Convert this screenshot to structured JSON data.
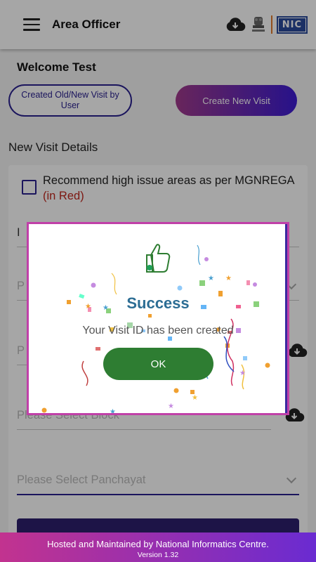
{
  "appbar": {
    "title": "Area Officer",
    "logo_text": "NIC"
  },
  "welcome": "Welcome Test",
  "buttons": {
    "created_visit": "Created Old/New Visit by User",
    "create_new": "Create New Visit"
  },
  "section_title": "New Visit Details",
  "recommend": {
    "text": "Recommend high issue areas as per MGNREGA ",
    "red_text": "(in Red)",
    "checked": false
  },
  "fields": {
    "field1_partial": "I",
    "field2_partial": "P",
    "field3_partial": "P",
    "block_placeholder": "Please Select Block",
    "panchayat_placeholder": "Please Select Panchayat"
  },
  "dialog": {
    "title": "Success",
    "message": "Your Visit ID has been created",
    "ok_label": "OK"
  },
  "footer": {
    "main": "Hosted and Maintained by National Informatics Centre.",
    "version": "Version 1.32"
  },
  "colors": {
    "primary": "#2a2190",
    "accent_gradient_start": "#a13a8c",
    "accent_gradient_end": "#3d1cd4",
    "success_green": "#2e7d32",
    "success_title": "#2c6d94",
    "red_note": "#c0271e"
  },
  "icons": {
    "menu": "hamburger-menu-icon",
    "download": "cloud-download-icon",
    "emblem": "state-emblem-icon",
    "thumb": "thumbs-up-icon"
  }
}
